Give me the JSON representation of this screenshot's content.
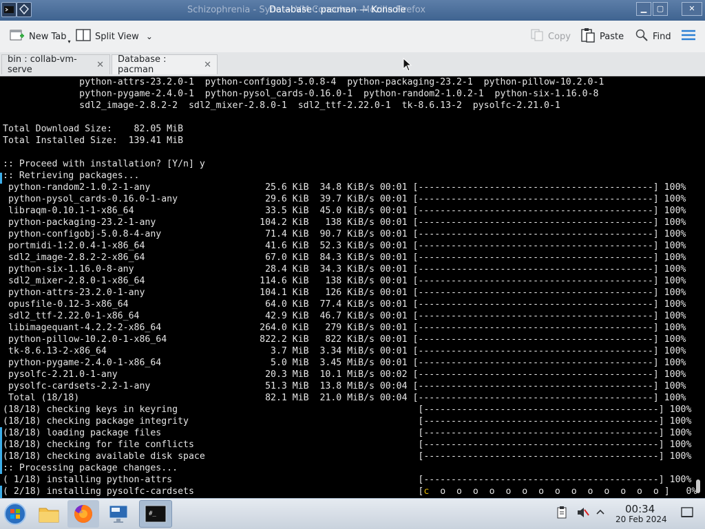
{
  "window": {
    "title_behind": "Schizophrenia - Sync — VM Console — Mozilla Firefox",
    "title": "Database : pacman — Konsole",
    "buttons": {
      "minimize": "▁",
      "maximize": "▢",
      "close": "✕"
    }
  },
  "toolbar": {
    "new_tab": "New Tab",
    "split_view": "Split View",
    "copy": "Copy",
    "paste": "Paste",
    "find": "Find"
  },
  "tabs": [
    {
      "label": "bin : collab-vm-serve",
      "active": false
    },
    {
      "label": "Database : pacman",
      "active": true
    }
  ],
  "terminal": {
    "lines_before_cursor": "              python-attrs-23.2.0-1  python-configobj-5.0.8-4  python-packaging-23.2-1  python-pillow-10.2.0-1\n              python-pygame-2.4.0-1  python-pysol_cards-0.16.0-1  python-random2-1.0.2-1  python-six-1.16.0-8\n              sdl2_image-2.8.2-2  sdl2_mixer-2.8.0-1  sdl2_ttf-2.22.0-1  tk-8.6.13-2  pysolfc-2.21.0-1\n\nTotal Download Size:    82.05 MiB\nTotal Installed Size:  139.41 MiB\n\n:: Proceed with installation? [Y/n] y\n:: Retrieving packages...\n python-random2-1.0.2-1-any                     25.6 KiB  34.8 KiB/s 00:01 [-------------------------------------------] 100%\n python-pysol_cards-0.16.0-1-any                29.6 KiB  39.7 KiB/s 00:01 [-------------------------------------------] 100%\n libraqm-0.10.1-1-x86_64                        33.5 KiB  45.0 KiB/s 00:01 [-------------------------------------------] 100%\n python-packaging-23.2-1-any                   104.2 KiB   138 KiB/s 00:01 [-------------------------------------------] 100%\n python-configobj-5.0.8-4-any                   71.4 KiB  90.7 KiB/s 00:01 [-------------------------------------------] 100%\n portmidi-1:2.0.4-1-x86_64                      41.6 KiB  52.3 KiB/s 00:01 [-------------------------------------------] 100%\n sdl2_image-2.8.2-2-x86_64                      67.0 KiB  84.3 KiB/s 00:01 [-------------------------------------------] 100%\n python-six-1.16.0-8-any                        28.4 KiB  34.3 KiB/s 00:01 [-------------------------------------------] 100%\n sdl2_mixer-2.8.0-1-x86_64                     114.6 KiB   138 KiB/s 00:01 [-------------------------------------------] 100%\n python-attrs-23.2.0-1-any                     104.1 KiB   126 KiB/s 00:01 [-------------------------------------------] 100%\n opusfile-0.12-3-x86_64                         64.0 KiB  77.4 KiB/s 00:01 [-------------------------------------------] 100%\n sdl2_ttf-2.22.0-1-x86_64                       42.9 KiB  46.7 KiB/s 00:01 [-------------------------------------------] 100%\n libimagequant-4.2.2-2-x86_64                  264.0 KiB   279 KiB/s 00:01 [-------------------------------------------] 100%\n python-pillow-10.2.0-1-x86_64                 822.2 KiB   822 KiB/s 00:01 [-------------------------------------------] 100%\n tk-8.6.13-2-x86_64                              3.7 MiB  3.34 MiB/s 00:01 [-------------------------------------------] 100%\n python-pygame-2.4.0-1-x86_64                    5.0 MiB  3.45 MiB/s 00:01 [-------------------------------------------] 100%\n pysolfc-2.21.0-1-any                           20.3 MiB  10.1 MiB/s 00:02 [-------------------------------------------] 100%\n pysolfc-cardsets-2.2-1-any                     51.3 MiB  13.8 MiB/s 00:04 [-------------------------------------------] 100%\n Total (18/18)                                  82.1 MiB  21.0 MiB/s 00:04 [-------------------------------------------] 100%\n(18/18) checking keys in keyring                                            [-------------------------------------------] 100%\n(18/18) checking package integrity                                          [-------------------------------------------] 100%\n(18/18) loading package files                                               [-------------------------------------------] 100%\n(18/18) checking for file conflicts                                         [-------------------------------------------] 100%\n(18/18) checking available disk space                                       [-------------------------------------------] 100%\n:: Processing package changes...\n( 1/18) installing python-attrs                                             [-------------------------------------------] 100%\n( 2/18) installing pysolfc-cardsets                                         [",
    "cursor_char": "c",
    "line_tail": "  o  o  o  o  o  o  o  o  o  o  o  o  o  o ]   0%"
  },
  "taskbar": {
    "clock_time": "00:34",
    "clock_date": "20 Feb 2024"
  },
  "colors": {
    "titlebar": "#4f6f99",
    "toolbar_bg": "#eff0f1",
    "terminal_bg": "#000000",
    "terminal_fg": "#e6e6e6",
    "accent": "#3daee9",
    "cursor": "#e6b800"
  }
}
